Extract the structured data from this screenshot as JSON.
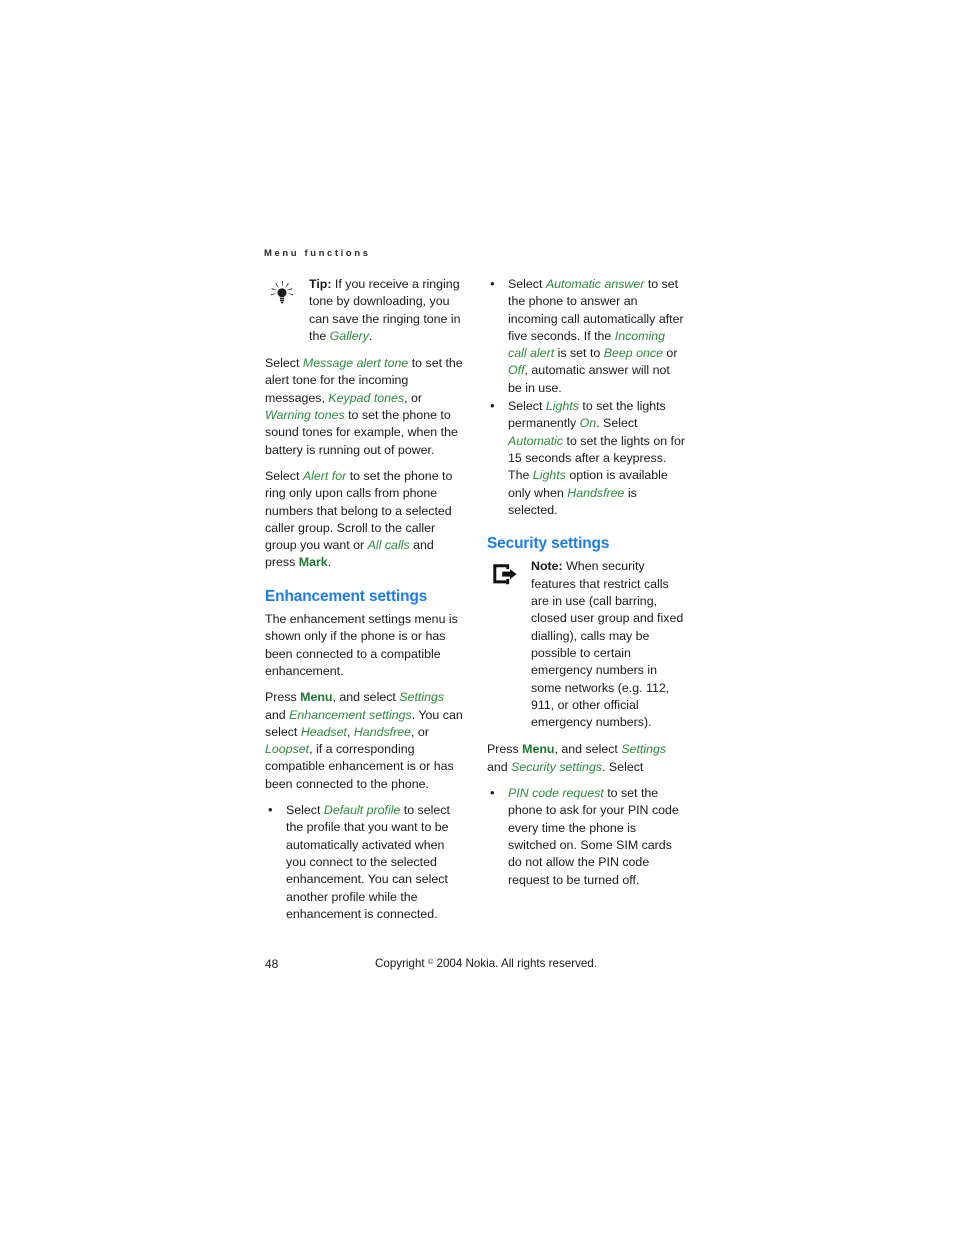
{
  "page": {
    "running_header": "Menu functions",
    "page_number": "48",
    "copyright_pre": "Copyright ",
    "copyright_symbol": "©",
    "copyright_post": " 2004 Nokia. All rights reserved.",
    "colors": {
      "heading_blue": "#1b7ce8",
      "term_green": "#2c8a3d",
      "softkey_green": "#1a7a2e",
      "body_text": "#1a1a1a",
      "background": "#ffffff"
    }
  },
  "left_column": {
    "tip_callout": {
      "icon": "lightbulb-icon",
      "lead": "Tip:",
      "text_1": " If you receive a ringing tone by downloading, you can save the ringing tone in the ",
      "term_1": "Gallery",
      "text_2": "."
    },
    "para_message_alert": {
      "t1": "Select ",
      "term_1": "Message alert tone",
      "t2": " to set the alert tone for the incoming messages, ",
      "term_2": "Keypad tones",
      "t3": ", or ",
      "term_3": "Warning tones",
      "t4": " to set the phone to sound tones for example, when the battery is running out of power."
    },
    "para_alert_for": {
      "t1": "Select ",
      "term_1": "Alert for",
      "t2": " to set the phone to ring only upon calls from phone numbers that belong to a selected caller group. Scroll to the caller group you want or ",
      "term_2": "All calls",
      "t3": " and press ",
      "softkey": "Mark",
      "t4": "."
    },
    "heading_enhancement": "Enhancement settings",
    "para_enhancement_intro": "The enhancement settings menu is shown only if the phone is or has been connected to a compatible enhancement.",
    "para_enhancement_press": {
      "t1": "Press ",
      "softkey": "Menu",
      "t2": ", and select ",
      "term_1": "Settings",
      "t3": " and ",
      "term_2": "Enhancement settings",
      "t4": ". You can select ",
      "term_3": "Headset",
      "t5": ", ",
      "term_4": "Handsfree",
      "t6": ", or ",
      "term_5": "Loopset",
      "t7": ", if a corresponding compatible enhancement is or has been connected to the phone."
    },
    "bullets": [
      {
        "t1": "Select ",
        "term_1": "Default profile",
        "t2": " to select the profile that you want to be automatically activated when you connect to the selected enhancement. You can select another profile while the enhancement is connected."
      }
    ]
  },
  "right_column": {
    "bullets_top": [
      {
        "t1": "Select ",
        "term_1": "Automatic answer",
        "t2": " to set the phone to answer an incoming call automatically after five seconds. If the ",
        "term_2": "Incoming call alert",
        "t3": " is set to ",
        "term_3": "Beep once",
        "t4": " or ",
        "term_4": "Off",
        "t5": ", automatic answer will not be in use."
      },
      {
        "t1": "Select ",
        "term_1": "Lights",
        "t2": " to set the lights permanently ",
        "term_2": "On",
        "t3": ". Select ",
        "term_3": "Automatic",
        "t4": " to set the lights on for 15 seconds after a keypress. The ",
        "term_4": "Lights",
        "t5": " option is available only when ",
        "term_5": "Handsfree",
        "t6": " is selected."
      }
    ],
    "heading_security": "Security settings",
    "note_callout": {
      "icon": "note-arrow-icon",
      "lead": "Note:",
      "text_1": " When security features that restrict calls are in use (call barring, closed user group and fixed dialling), calls may be possible to certain emergency numbers in some networks (e.g. 112, 911, or other official emergency numbers)."
    },
    "para_security_press": {
      "t1": "Press ",
      "softkey": "Menu",
      "t2": ", and select ",
      "term_1": "Settings",
      "t3": " and ",
      "term_2": "Security settings",
      "t4": ". Select"
    },
    "bullets_bottom": [
      {
        "term_1": "PIN code request",
        "t1": " to set the phone to ask for your PIN code every time the phone is switched on. Some SIM cards do not allow the PIN code request to be turned off."
      }
    ]
  }
}
